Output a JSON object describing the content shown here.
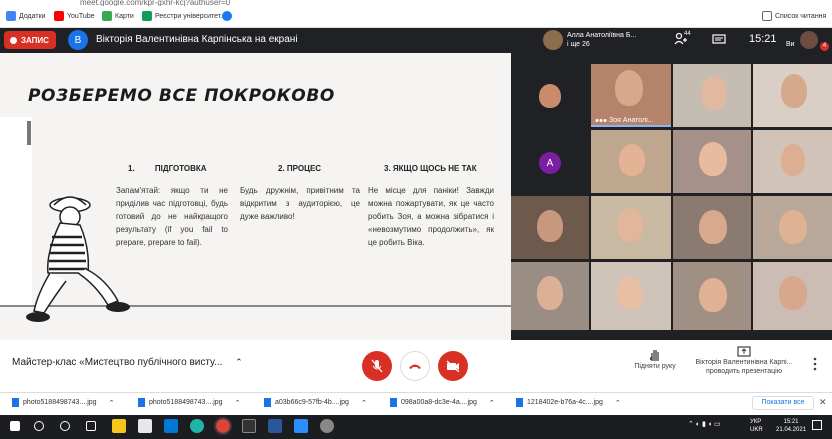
{
  "browser": {
    "url": "meet.google.com/kpr-gxhr-kcj?authuser=0",
    "bookmarks": [
      {
        "label": "Додатки",
        "icon": "apps-grid-icon"
      },
      {
        "label": "YouTube",
        "icon": "youtube-icon"
      },
      {
        "label": "Карти",
        "icon": "maps-pin-icon"
      },
      {
        "label": "Реєстри університет...",
        "icon": "sheets-icon"
      },
      {
        "label": "",
        "icon": "facebook-icon"
      }
    ],
    "reading_list": "Список читання"
  },
  "meet_top": {
    "record_label": "ЗАПИС",
    "presenter_initial": "В",
    "presenting_text": "Вікторія Валентинівна Карпінська на екрані",
    "participant_name": "Алла Анатоліївна Б...",
    "participant_more": "і ще 26",
    "participants_count": "44",
    "time": "15:21",
    "me_label": "Ви",
    "notification_count": "4"
  },
  "slide": {
    "title": "РОЗБЕРЕМО ВСЕ ПОКРОКОВО",
    "columns": [
      {
        "number": "1.",
        "heading": "ПІДГОТОВКА",
        "body": "Запам'ятай: якщо ти не приділив час підготовці, будь готовий до не найкращого результату (if you fail to prepare, prepare to fail)."
      },
      {
        "number": "2.",
        "heading": "ПРОЦЕС",
        "body": "Будь дружнім, привітним та відкритим з аудиторією, це дуже важливо!"
      },
      {
        "number": "3.",
        "heading": "ЯКЩО ЩОСЬ НЕ ТАК",
        "body": "Не місце для паніки! Завжди можна пожартувати, як це часто робить Зоя, а можна зібратися і «невозмутимо продолжить», як це робить Віка."
      }
    ]
  },
  "grid": {
    "active_speaker_name": "Зоя Анатолі...",
    "avatar_initial": "А"
  },
  "controls": {
    "meeting_title": "Майстер-клас «Мистецтво публічного висту...",
    "raise_hand": "Підняти руку",
    "presenter_line1": "Вікторія Валентинівна Карпі...",
    "presenter_line2": "проводить презентацію"
  },
  "downloads": {
    "items": [
      "photo5188498743....jpg",
      "photo5188498743....jpg",
      "a03b66c9-57fb-4b....jpg",
      "098a00a8-dc3e-4a....jpg",
      "1218402e-b76a-4c....jpg"
    ],
    "show_all": "Показати все"
  },
  "taskbar": {
    "lang1": "УКР",
    "lang2": "UKR",
    "clock_time": "15:21",
    "clock_date": "21.04.2021"
  },
  "colors": {
    "record_red": "#d93025",
    "meet_dark": "#202124",
    "presenter_blue": "#1a73e8",
    "slide_bg": "#f5f4f2"
  }
}
